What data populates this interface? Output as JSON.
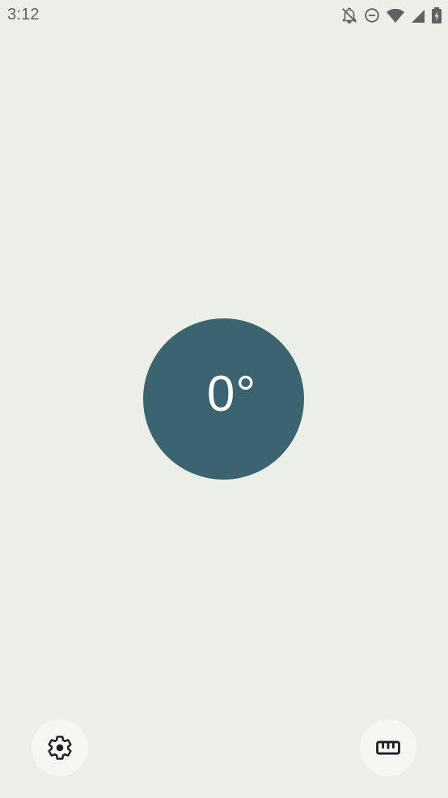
{
  "status_bar": {
    "time": "3:12",
    "icons": [
      "notifications-off-icon",
      "do-not-disturb-icon",
      "wifi-icon",
      "cell-signal-icon",
      "battery-charging-icon"
    ]
  },
  "level": {
    "value": "0°"
  },
  "actions": {
    "settings_icon": "gear-icon",
    "calibrate_icon": "ruler-icon"
  },
  "colors": {
    "background": "#eceee8",
    "circle": "#3b6470",
    "button_bg": "#f5f7f2"
  }
}
